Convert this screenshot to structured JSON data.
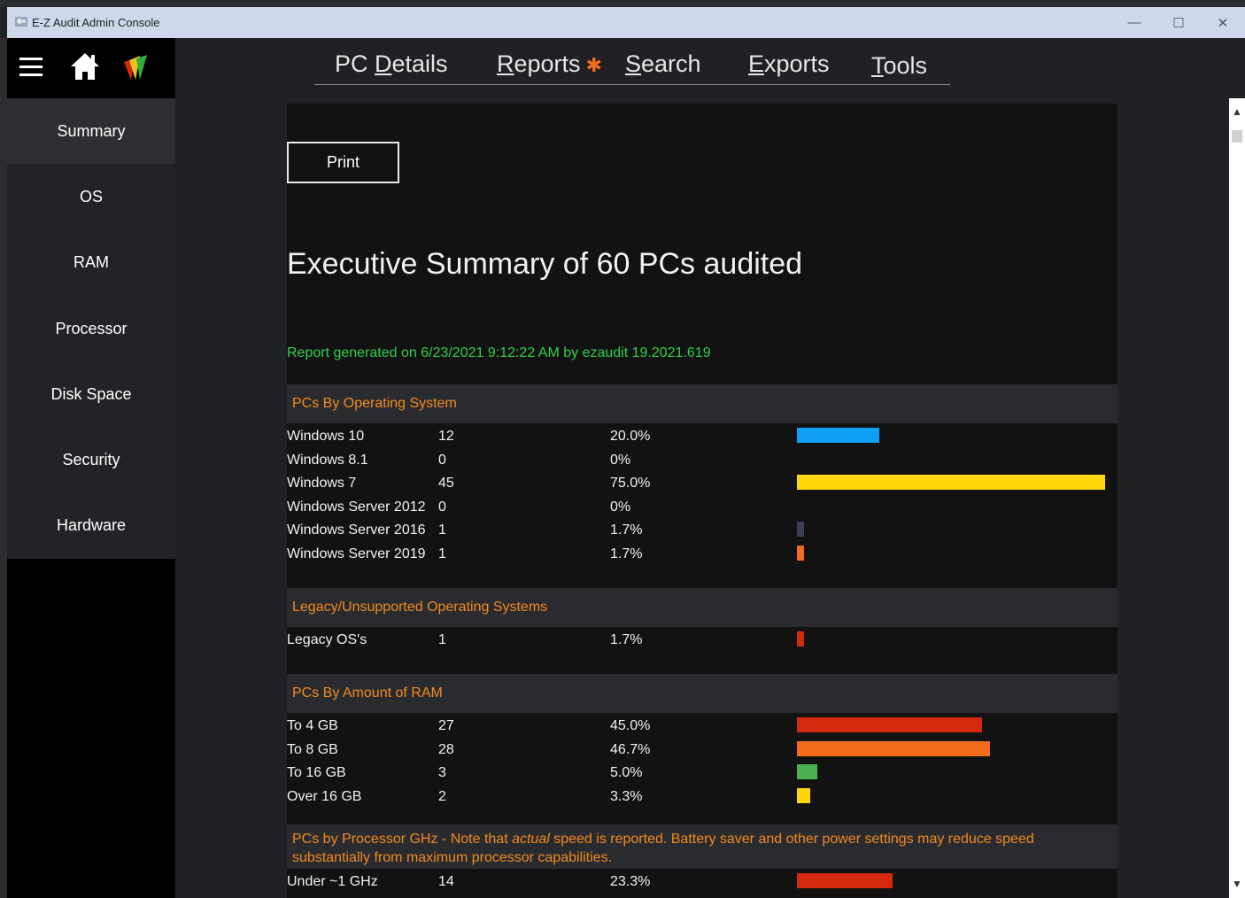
{
  "window": {
    "title": "E-Z Audit Admin Console",
    "minimize": "—",
    "maximize": "☐",
    "close": "✕"
  },
  "nav": {
    "pc_details": {
      "accel": "PC ",
      "u": "D",
      "rest": "etails"
    },
    "reports": {
      "u": "R",
      "rest": "eports",
      "star": "✱"
    },
    "search": {
      "u": "S",
      "rest": "earch"
    },
    "exports": {
      "u": "E",
      "rest": "xports"
    },
    "tools": {
      "u": "T",
      "rest": "ools"
    }
  },
  "sidebar": {
    "items": [
      {
        "label": "Summary"
      },
      {
        "label": "OS"
      },
      {
        "label": "RAM"
      },
      {
        "label": "Processor"
      },
      {
        "label": "Disk Space"
      },
      {
        "label": "Security"
      },
      {
        "label": "Hardware"
      }
    ]
  },
  "report": {
    "print_label": "Print",
    "title": "Executive Summary of 60 PCs audited",
    "meta": "Report generated on 6/23/2021 9:12:22 AM by ezaudit 19.2021.619"
  },
  "sections": {
    "os": {
      "header": "PCs By Operating System",
      "rows": [
        {
          "name": "Windows 10",
          "count": "12",
          "pct": "20.0%",
          "ratio": 0.2667,
          "color": "#0fa0f5"
        },
        {
          "name": "Windows 8.1",
          "count": "0",
          "pct": "0%",
          "ratio": 0,
          "color": "#0fa0f5"
        },
        {
          "name": "Windows 7",
          "count": "45",
          "pct": "75.0%",
          "ratio": 1.0,
          "color": "#ffd60a"
        },
        {
          "name": "Windows Server 2012",
          "count": "0",
          "pct": "0%",
          "ratio": 0,
          "color": "#3a3f55"
        },
        {
          "name": "Windows Server 2016",
          "count": "1",
          "pct": "1.7%",
          "ratio": 0.022,
          "color": "#3a3f55"
        },
        {
          "name": "Windows Server 2019",
          "count": "1",
          "pct": "1.7%",
          "ratio": 0.022,
          "color": "#f36b1c"
        }
      ]
    },
    "legacy": {
      "header": "Legacy/Unsupported Operating Systems",
      "rows": [
        {
          "name": "Legacy OS's",
          "count": "1",
          "pct": "1.7%",
          "ratio": 0.022,
          "color": "#d4290f"
        }
      ]
    },
    "ram": {
      "header": "PCs By Amount of RAM",
      "rows": [
        {
          "name": "To 4 GB",
          "count": "27",
          "pct": "45.0%",
          "ratio": 0.6,
          "color": "#d4290f"
        },
        {
          "name": "To 8 GB",
          "count": "28",
          "pct": "46.7%",
          "ratio": 0.625,
          "color": "#f36b1c"
        },
        {
          "name": "To 16 GB",
          "count": "3",
          "pct": "5.0%",
          "ratio": 0.067,
          "color": "#4caf50"
        },
        {
          "name": "Over 16 GB",
          "count": "2",
          "pct": "3.3%",
          "ratio": 0.044,
          "color": "#ffd60a"
        }
      ]
    },
    "cpu": {
      "header_a": "PCs by Processor GHz - Note that ",
      "header_em": "actual",
      "header_b": " speed is reported.  Battery saver and other power settings may reduce speed substantially from maximum processor capabilities.",
      "rows": [
        {
          "name": "Under ~1 GHz",
          "count": "14",
          "pct": "23.3%",
          "ratio": 0.31,
          "color": "#d4290f"
        }
      ]
    }
  },
  "colors": {
    "accent_orange": "#f08a22",
    "report_green": "#2fcf4b"
  }
}
